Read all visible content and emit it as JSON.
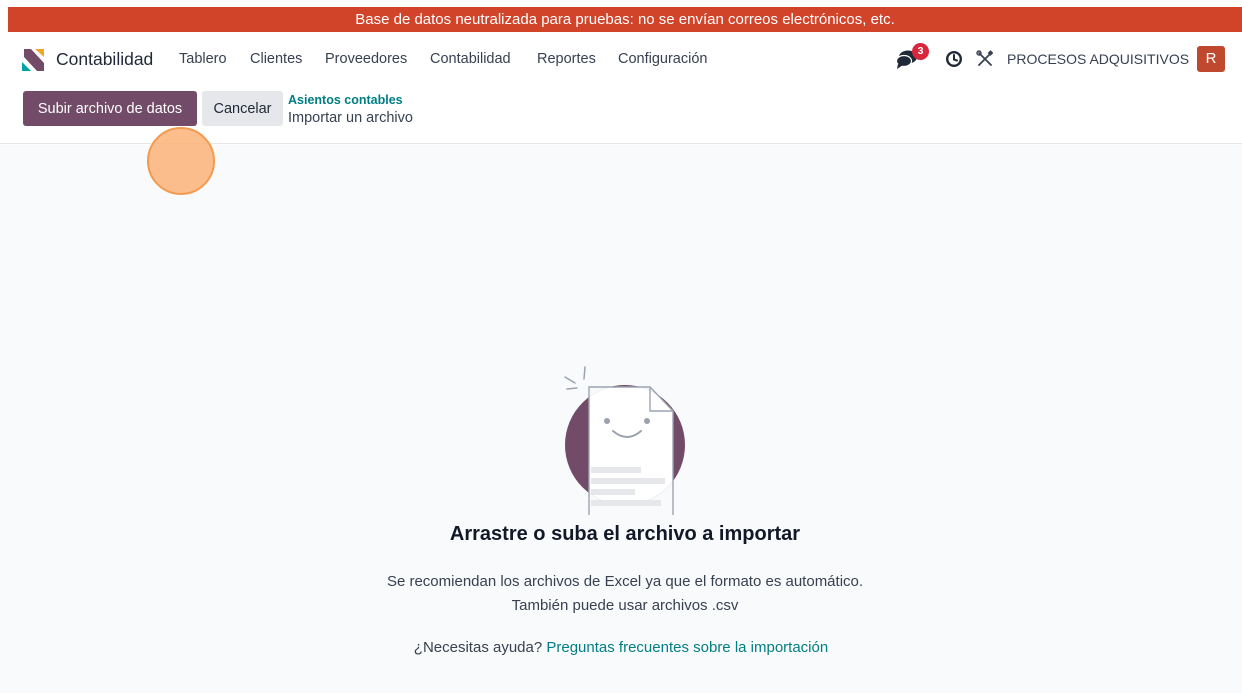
{
  "banner": {
    "text": "Base de datos neutralizada para pruebas: no se envían correos electrónicos, etc."
  },
  "navbar": {
    "app_name": "Contabilidad",
    "menu": [
      {
        "label": "Tablero"
      },
      {
        "label": "Clientes"
      },
      {
        "label": "Proveedores"
      },
      {
        "label": "Contabilidad"
      },
      {
        "label": "Reportes"
      },
      {
        "label": "Configuración"
      }
    ],
    "messages_count": "3",
    "company": "PROCESOS ADQUISITIVOS",
    "avatar_initial": "R"
  },
  "control_panel": {
    "upload_button": "Subir archivo de datos",
    "cancel_button": "Cancelar",
    "breadcrumb_parent": "Asientos contables",
    "breadcrumb_current": "Importar un archivo"
  },
  "dropzone": {
    "title": "Arrastre o suba el archivo a importar",
    "hint_line1": "Se recomiendan los archivos de Excel ya que el formato es automático.",
    "hint_line2": "También puede usar archivos .csv",
    "help_prefix": "¿Necesitas ayuda?",
    "help_link": "Preguntas frecuentes sobre la importación"
  },
  "colors": {
    "banner": "#d1442a",
    "primary": "#714b67",
    "link": "#017e84",
    "badge": "#d7263d",
    "avatar": "#c0482f"
  },
  "icons": [
    "app-logo-icon",
    "messages-icon",
    "activity-clock-icon",
    "debug-tools-icon",
    "empty-file-illustration"
  ]
}
